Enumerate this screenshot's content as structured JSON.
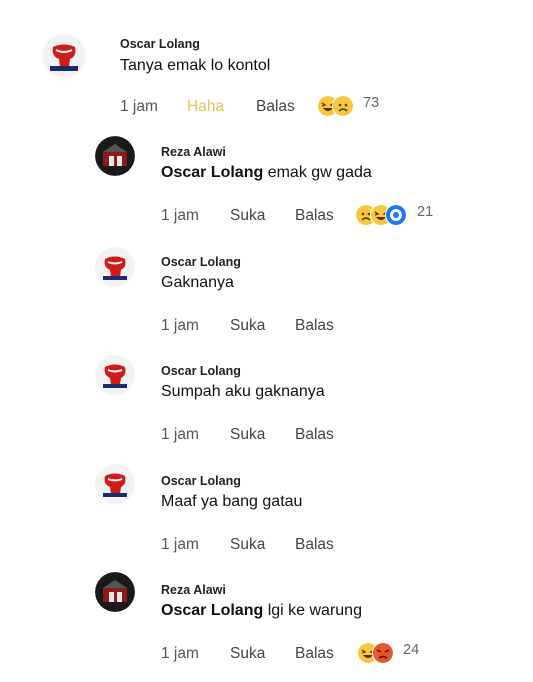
{
  "comments": [
    {
      "name": "Oscar Lolang",
      "mention": "",
      "text": "Tanya emak lo kontol",
      "time": "1 jam",
      "like": "Haha",
      "reply": "Balas",
      "reactions": [
        "haha",
        "sad"
      ],
      "count": "73"
    },
    {
      "name": "Reza Alawi",
      "mention": "Oscar Lolang",
      "text": "emak gw gada",
      "time": "1 jam",
      "like": "Suka",
      "reply": "Balas",
      "reactions": [
        "sad",
        "haha",
        "wow"
      ],
      "count": "21"
    },
    {
      "name": "Oscar Lolang",
      "mention": "",
      "text": "Gaknanya",
      "time": "1 jam",
      "like": "Suka",
      "reply": "Balas",
      "reactions": [],
      "count": ""
    },
    {
      "name": "Oscar Lolang",
      "mention": "",
      "text": "Sumpah aku gaknanya",
      "time": "1 jam",
      "like": "Suka",
      "reply": "Balas",
      "reactions": [],
      "count": ""
    },
    {
      "name": "Oscar Lolang",
      "mention": "",
      "text": "Maaf ya bang gatau",
      "time": "1 jam",
      "like": "Suka",
      "reply": "Balas",
      "reactions": [],
      "count": ""
    },
    {
      "name": "Reza Alawi",
      "mention": "Oscar Lolang",
      "text": "lgi ke warung",
      "time": "1 jam",
      "like": "Suka",
      "reply": "Balas",
      "reactions": [
        "haha",
        "angry"
      ],
      "count": "24"
    }
  ],
  "colors": {
    "text": "#1c1e21",
    "secondary": "#555555",
    "haha_active": "#e7c35a",
    "reaction_yellow": "#f7c83e",
    "reaction_angry": "#e8572c",
    "reaction_wow_blue": "#1877f2"
  }
}
